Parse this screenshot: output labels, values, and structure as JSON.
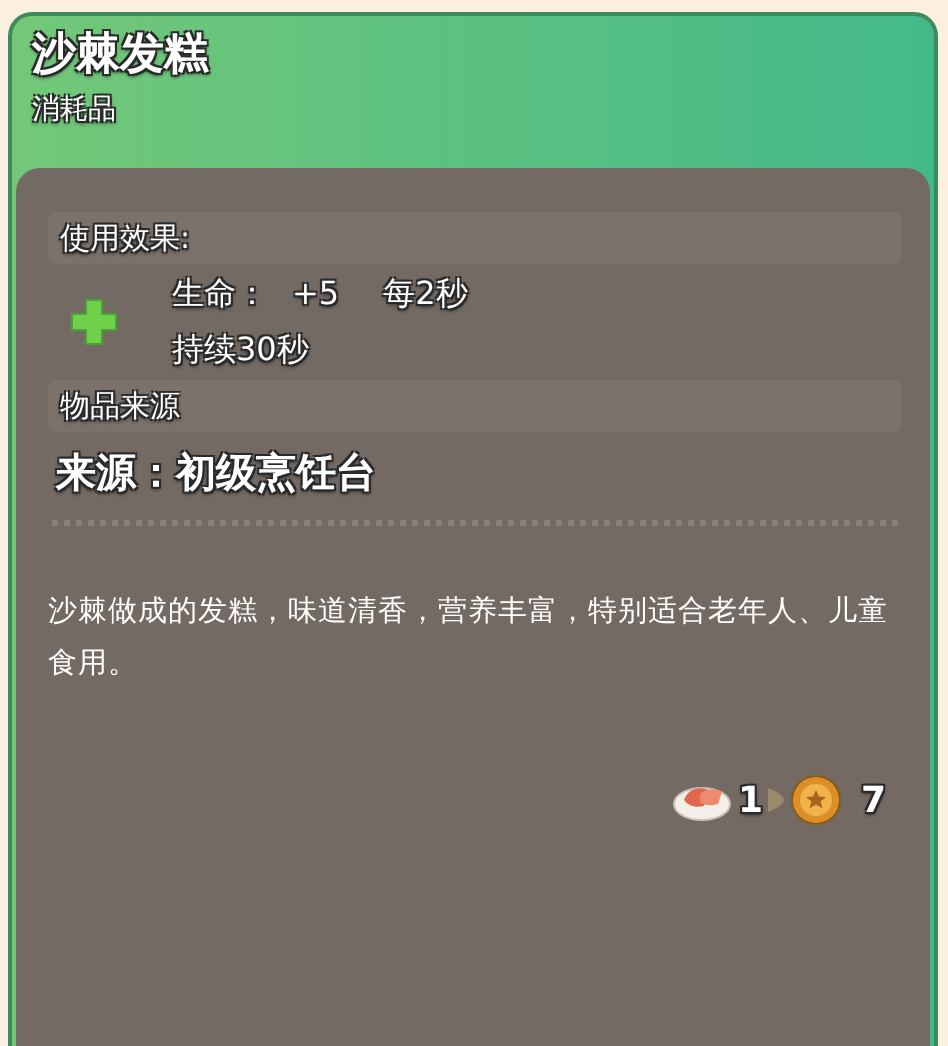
{
  "header": {
    "title": "沙棘发糕",
    "category": "消耗品"
  },
  "effects_section": {
    "heading": "使用效果:",
    "effect": {
      "stat": "生命：",
      "amount": "+5",
      "interval": "每2秒",
      "duration": "持续30秒"
    }
  },
  "source_section": {
    "heading": "物品来源",
    "source": "来源：初级烹饪台"
  },
  "description": "沙棘做成的发糕，味道清香，营养丰富，特别适合老年人、儿童食用。",
  "exchange": {
    "quantity": "1",
    "price": "7"
  }
}
